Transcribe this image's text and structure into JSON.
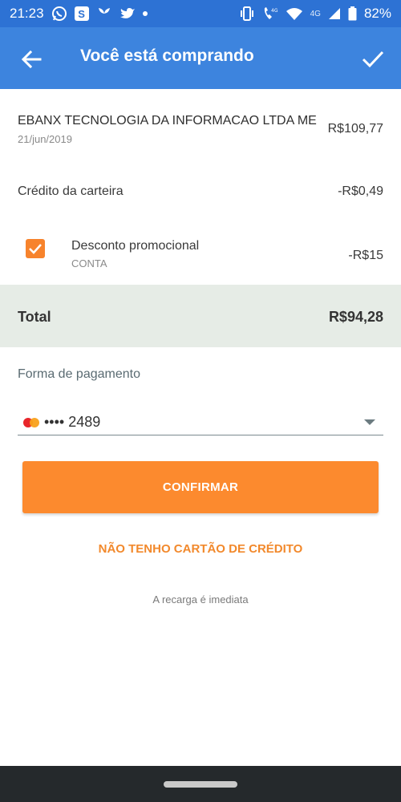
{
  "status_bar": {
    "time": "21:23",
    "left_icons": [
      "whatsapp-icon",
      "skype-icon",
      "plant-icon",
      "twitter-icon",
      "dot-icon"
    ],
    "right_icons": [
      "vibrate-icon",
      "volte-call-icon",
      "wifi-icon",
      "signal-icon",
      "battery-icon"
    ],
    "network_label": "4G",
    "battery": "82%"
  },
  "app_bar": {
    "title": "Você está comprando",
    "background": "#3d84de"
  },
  "purchase": {
    "merchant_name": "EBANX TECNOLOGIA DA INFORMACAO LTDA ME",
    "date": "21/jun/2019",
    "amount": "R$109,77"
  },
  "wallet_credit": {
    "label": "Crédito da carteira",
    "amount": "-R$0,49"
  },
  "discount": {
    "checked": true,
    "label": "Desconto promocional",
    "sublabel": "CONTA",
    "amount": "-R$15"
  },
  "total": {
    "label": "Total",
    "amount": "R$94,28"
  },
  "payment": {
    "label": "Forma de pagamento",
    "card_brand": "mastercard-icon",
    "card_text": "•••• 2489"
  },
  "actions": {
    "confirm_label": "CONFIRMAR",
    "no_card_label": "NÃO TENHO CARTÃO DE CRÉDITO",
    "info_text": "A recarga é imediata"
  },
  "colors": {
    "accent_orange": "#fc8a2e",
    "header_blue": "#3d84de",
    "status_blue": "#2d72d4",
    "total_band": "#e6ece6"
  }
}
